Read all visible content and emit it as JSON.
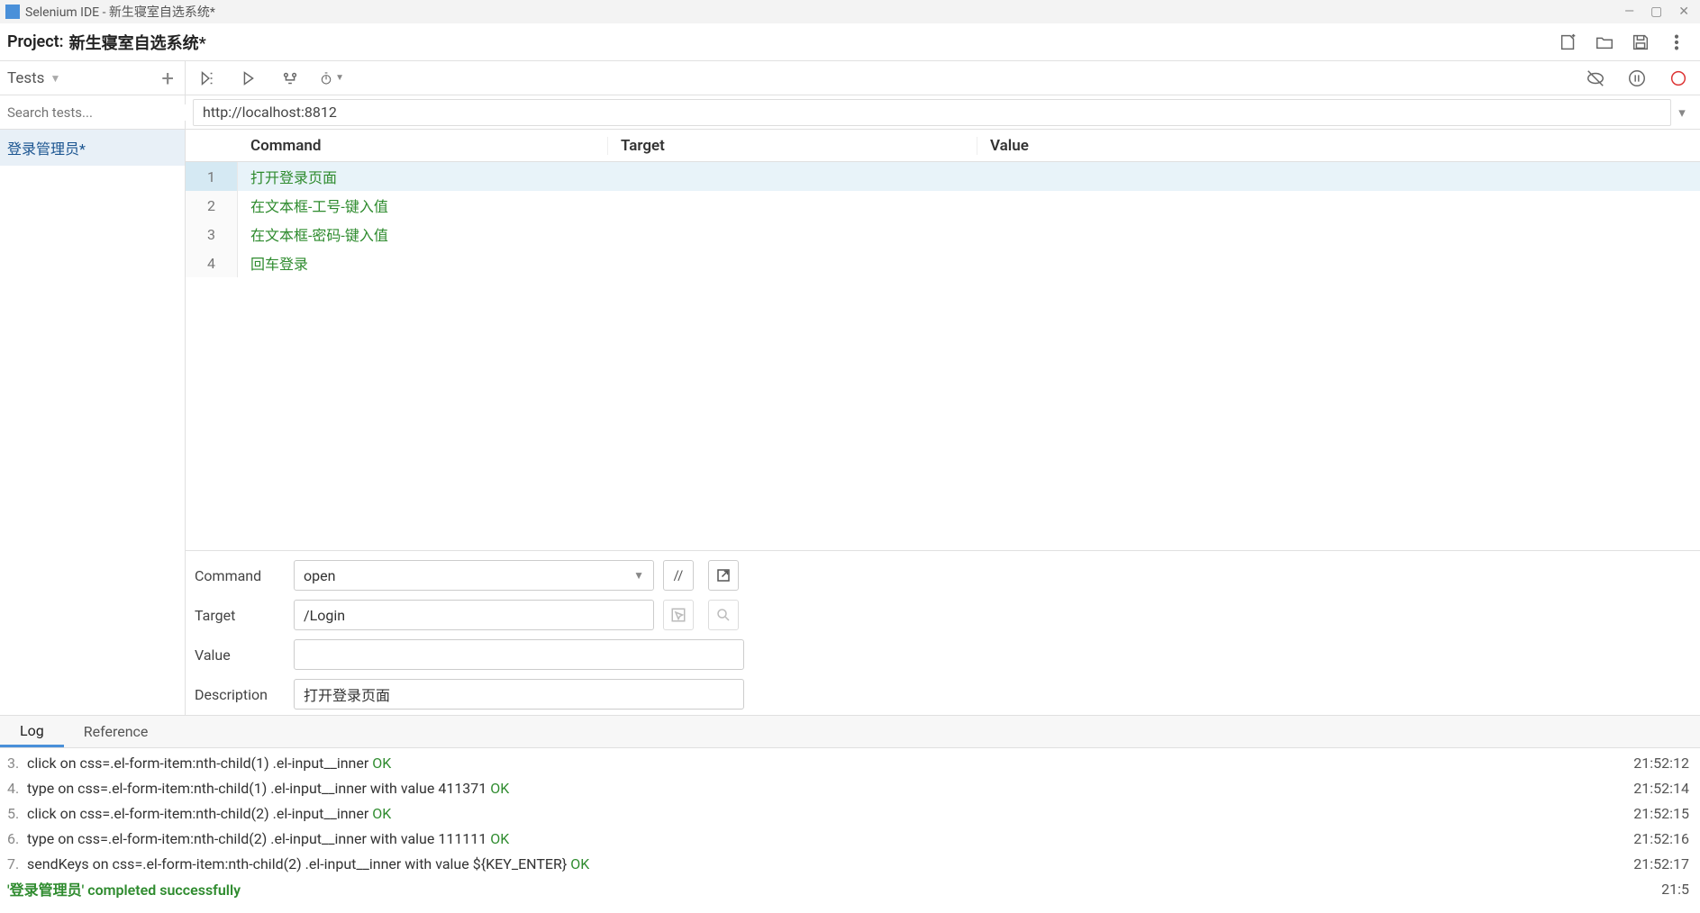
{
  "window": {
    "title": "Selenium IDE - 新生寝室自选系统*"
  },
  "project": {
    "label": "Project:",
    "name": "新生寝室自选系统*"
  },
  "sidebar": {
    "heading": "Tests",
    "search_placeholder": "Search tests...",
    "tests": [
      {
        "name": "登录管理员*"
      }
    ]
  },
  "toolbar": {
    "base_url": "http://localhost:8812"
  },
  "table": {
    "headers": {
      "command": "Command",
      "target": "Target",
      "value": "Value"
    },
    "rows": [
      {
        "n": "1",
        "command": "打开登录页面",
        "target": "",
        "value": ""
      },
      {
        "n": "2",
        "command": "在文本框-工号-键入值",
        "target": "",
        "value": ""
      },
      {
        "n": "3",
        "command": "在文本框-密码-键入值",
        "target": "",
        "value": ""
      },
      {
        "n": "4",
        "command": "回车登录",
        "target": "",
        "value": ""
      }
    ]
  },
  "editor": {
    "labels": {
      "command": "Command",
      "target": "Target",
      "value": "Value",
      "description": "Description"
    },
    "command": "open",
    "target": "/Login",
    "value": "",
    "description": "打开登录页面",
    "toggle_comment": "//"
  },
  "bottom": {
    "tabs": {
      "log": "Log",
      "reference": "Reference"
    },
    "log": [
      {
        "idx": "3.",
        "text": "click on css=.el-form-item:nth-child(1) .el-input__inner ",
        "status": "OK",
        "ts": "21:52:12"
      },
      {
        "idx": "4.",
        "text": "type on css=.el-form-item:nth-child(1) .el-input__inner with value 411371 ",
        "status": "OK",
        "ts": "21:52:14"
      },
      {
        "idx": "5.",
        "text": "click on css=.el-form-item:nth-child(2) .el-input__inner ",
        "status": "OK",
        "ts": "21:52:15"
      },
      {
        "idx": "6.",
        "text": "type on css=.el-form-item:nth-child(2) .el-input__inner with value 111111 ",
        "status": "OK",
        "ts": "21:52:16"
      },
      {
        "idx": "7.",
        "text": "sendKeys on css=.el-form-item:nth-child(2) .el-input__inner with value ${KEY_ENTER} ",
        "status": "OK",
        "ts": "21:52:17"
      }
    ],
    "final": "'登录管理员' completed successfully",
    "final_ts": "21:5"
  }
}
